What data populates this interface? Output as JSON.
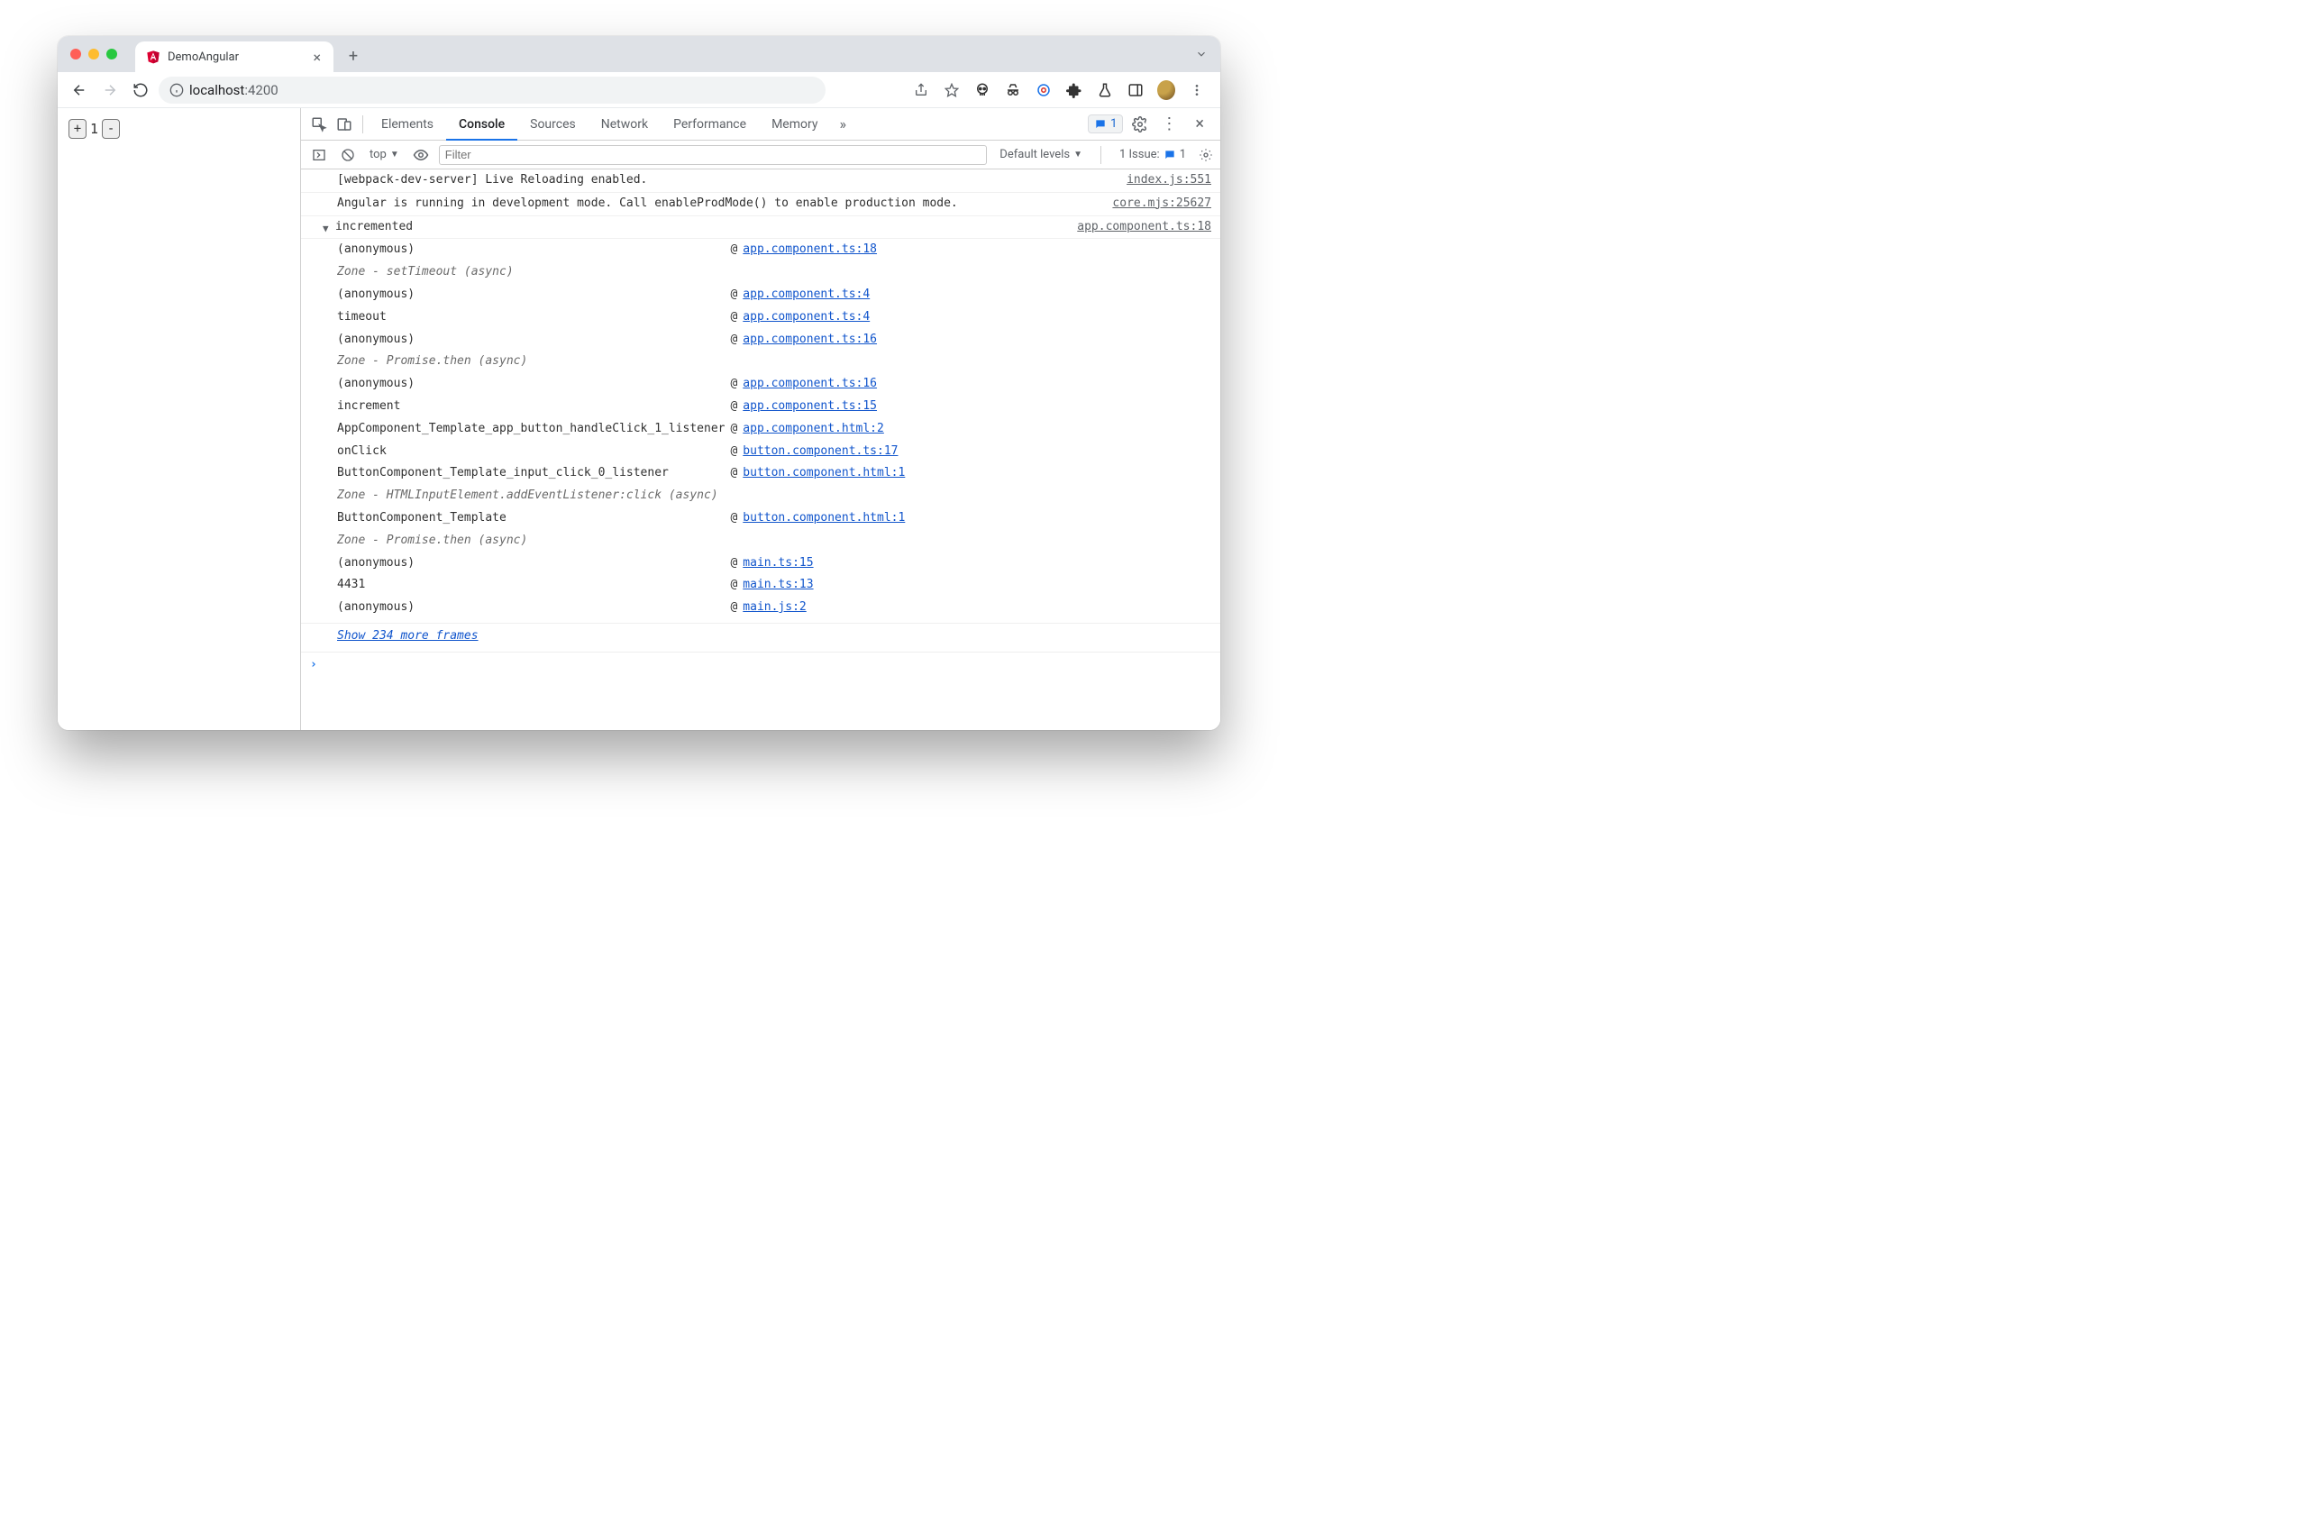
{
  "browser": {
    "tab_title": "DemoAngular",
    "url_host": "localhost",
    "url_port": ":4200"
  },
  "page": {
    "plus": "+",
    "count": "1",
    "minus": "-"
  },
  "devtools": {
    "tabs": [
      "Elements",
      "Console",
      "Sources",
      "Network",
      "Performance",
      "Memory"
    ],
    "active_tab": "Console",
    "msg_count": "1",
    "issues_label": "1 Issue:",
    "issues_count": "1"
  },
  "console_toolbar": {
    "context": "top",
    "filter_placeholder": "Filter",
    "levels": "Default levels"
  },
  "console": {
    "lines": [
      {
        "msg": "[webpack-dev-server] Live Reloading enabled.",
        "src": "index.js:551"
      },
      {
        "msg": "Angular is running in development mode. Call enableProdMode() to enable production mode.",
        "src": "core.mjs:25627"
      }
    ],
    "trace_label": "incremented",
    "trace_src": "app.component.ts:18",
    "stack": [
      {
        "type": "frame",
        "fn": "(anonymous)",
        "link": "app.component.ts:18"
      },
      {
        "type": "zone",
        "text": "Zone - setTimeout (async)"
      },
      {
        "type": "frame",
        "fn": "(anonymous)",
        "link": "app.component.ts:4"
      },
      {
        "type": "frame",
        "fn": "timeout",
        "link": "app.component.ts:4"
      },
      {
        "type": "frame",
        "fn": "(anonymous)",
        "link": "app.component.ts:16"
      },
      {
        "type": "zone",
        "text": "Zone - Promise.then (async)"
      },
      {
        "type": "frame",
        "fn": "(anonymous)",
        "link": "app.component.ts:16"
      },
      {
        "type": "frame",
        "fn": "increment",
        "link": "app.component.ts:15"
      },
      {
        "type": "frame",
        "fn": "AppComponent_Template_app_button_handleClick_1_listener",
        "link": "app.component.html:2"
      },
      {
        "type": "frame",
        "fn": "onClick",
        "link": "button.component.ts:17"
      },
      {
        "type": "frame",
        "fn": "ButtonComponent_Template_input_click_0_listener",
        "link": "button.component.html:1"
      },
      {
        "type": "zone",
        "text": "Zone - HTMLInputElement.addEventListener:click (async)"
      },
      {
        "type": "frame",
        "fn": "ButtonComponent_Template",
        "link": "button.component.html:1"
      },
      {
        "type": "zone",
        "text": "Zone - Promise.then (async)"
      },
      {
        "type": "frame",
        "fn": "(anonymous)",
        "link": "main.ts:15"
      },
      {
        "type": "frame",
        "fn": "4431",
        "link": "main.ts:13"
      },
      {
        "type": "frame",
        "fn": "(anonymous)",
        "link": "main.js:2"
      }
    ],
    "more_frames": "Show 234 more frames"
  }
}
